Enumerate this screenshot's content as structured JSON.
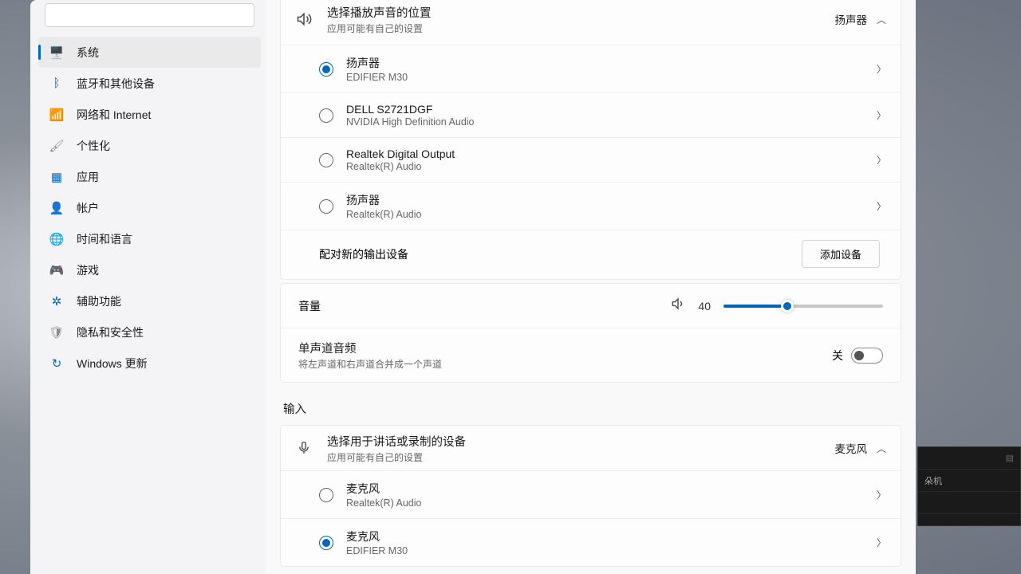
{
  "search": {
    "placeholder": ""
  },
  "sidebar": {
    "items": [
      {
        "label": "系统",
        "icon": "🖥️",
        "cls": "ic-blue"
      },
      {
        "label": "蓝牙和其他设备",
        "icon": "ᛒ",
        "cls": "ic-blue"
      },
      {
        "label": "网络和 Internet",
        "icon": "📶",
        "cls": "ic-blue"
      },
      {
        "label": "个性化",
        "icon": "🖌",
        "cls": "ic-gray"
      },
      {
        "label": "应用",
        "icon": "▦",
        "cls": "ic-blue"
      },
      {
        "label": "帐户",
        "icon": "👤",
        "cls": "ic-blue"
      },
      {
        "label": "时间和语言",
        "icon": "🌐",
        "cls": "ic-blue"
      },
      {
        "label": "游戏",
        "icon": "🎮",
        "cls": "ic-gray"
      },
      {
        "label": "辅助功能",
        "icon": "✲",
        "cls": "ic-blue"
      },
      {
        "label": "隐私和安全性",
        "icon": "🛡",
        "cls": "ic-gray"
      },
      {
        "label": "Windows 更新",
        "icon": "↻",
        "cls": "ic-blue"
      }
    ]
  },
  "output": {
    "header": {
      "title": "选择播放声音的位置",
      "sub": "应用可能有自己的设置",
      "current": "扬声器"
    },
    "devices": [
      {
        "name": "扬声器",
        "sub": "EDIFIER M30",
        "selected": true
      },
      {
        "name": "DELL S2721DGF",
        "sub": "NVIDIA High Definition Audio",
        "selected": false
      },
      {
        "name": "Realtek Digital Output",
        "sub": "Realtek(R) Audio",
        "selected": false
      },
      {
        "name": "扬声器",
        "sub": "Realtek(R) Audio",
        "selected": false
      }
    ],
    "pair_label": "配对新的输出设备",
    "pair_button": "添加设备"
  },
  "volume": {
    "label": "音量",
    "value": "40",
    "percent": 40
  },
  "mono": {
    "title": "单声道音频",
    "sub": "将左声道和右声道合并成一个声道",
    "state": "关"
  },
  "input_section": "输入",
  "input": {
    "header": {
      "title": "选择用于讲话或录制的设备",
      "sub": "应用可能有自己的设置",
      "current": "麦克风"
    },
    "devices": [
      {
        "name": "麦克风",
        "sub": "Realtek(R) Audio",
        "selected": false
      },
      {
        "name": "麦克风",
        "sub": "EDIFIER M30",
        "selected": true
      }
    ]
  },
  "peek": {
    "row1": "",
    "row2": "朵机"
  }
}
